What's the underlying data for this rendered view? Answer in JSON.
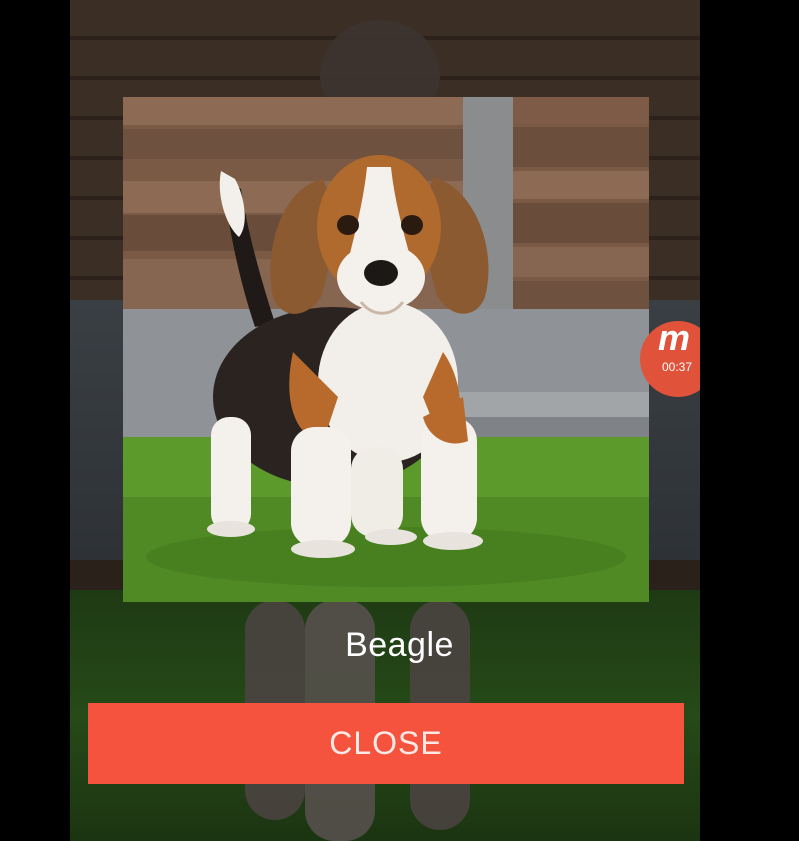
{
  "dialog": {
    "caption": "Beagle",
    "close_label": "CLOSE",
    "image_alt": "Beagle puppy standing on grass",
    "image_icon": "beagle-photo"
  },
  "recorder": {
    "logo": "m",
    "elapsed": "00:37",
    "color": "#e0533a"
  },
  "colors": {
    "close_button": "#f5533d",
    "caption_text": "#ffffff",
    "background": "#000000"
  }
}
